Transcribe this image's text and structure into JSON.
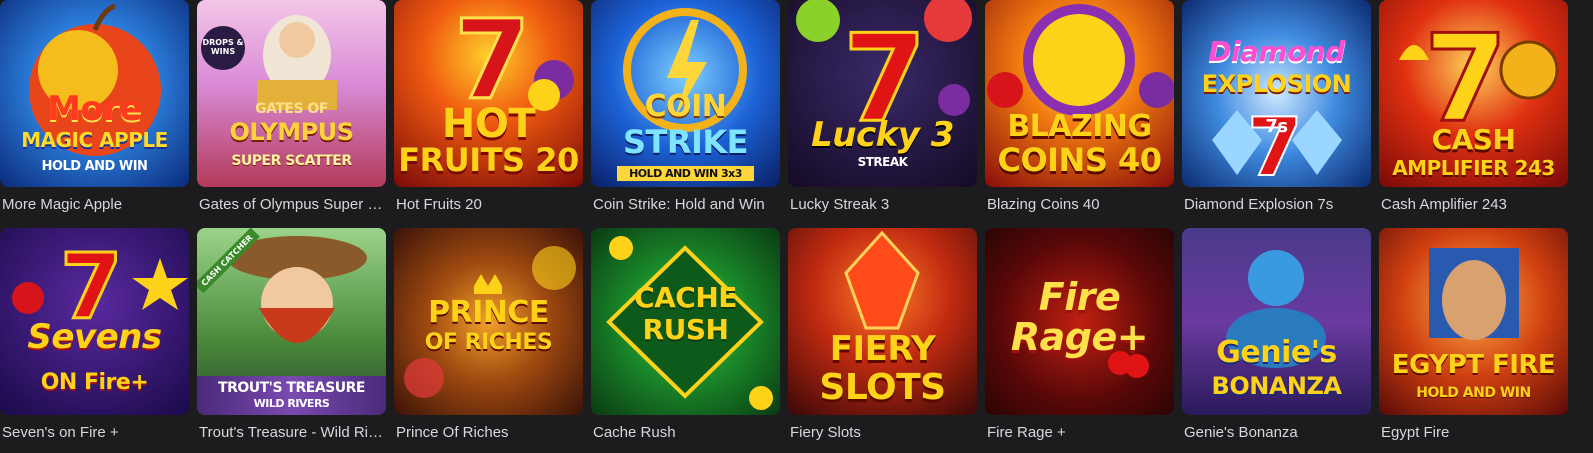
{
  "games": [
    {
      "name": "More Magic Apple",
      "art": {
        "line1": "More",
        "line2": "MAGIC APPLE",
        "line3": "HOLD AND WIN"
      }
    },
    {
      "name": "Gates of Olympus Super Scatter",
      "art": {
        "line1": "GATES OF",
        "line2": "OLYMPUS",
        "line3": "SUPER SCATTER",
        "badge": "DROPS & WINS"
      }
    },
    {
      "name": "Hot Fruits 20",
      "art": {
        "line1": "HOT",
        "line2": "FRUITS 20"
      }
    },
    {
      "name": "Coin Strike: Hold and Win",
      "art": {
        "line1": "COIN",
        "line2": "STRIKE",
        "line3": "HOLD AND WIN 3x3"
      }
    },
    {
      "name": "Lucky Streak 3",
      "art": {
        "line1": "Lucky 3",
        "line2": "STREAK"
      }
    },
    {
      "name": "Blazing Coins 40",
      "art": {
        "line1": "BLAZING",
        "line2": "COINS 40"
      }
    },
    {
      "name": "Diamond Explosion 7s",
      "art": {
        "line1": "Diamond",
        "line2": "EXPLOSION",
        "line3": "7s"
      }
    },
    {
      "name": "Cash Amplifier 243",
      "art": {
        "line1": "CASH",
        "line2": "AMPLIFIER 243"
      }
    },
    {
      "name": "Seven's on Fire +",
      "art": {
        "line1": "Sevens",
        "line2": "ON Fire+"
      }
    },
    {
      "name": "Trout's Treasure - Wild Rivers",
      "art": {
        "line1": "TROUT'S TREASURE",
        "line2": "WILD RIVERS",
        "badge": "CASH CATCHER"
      }
    },
    {
      "name": "Prince Of Riches",
      "art": {
        "line1": "PRINCE",
        "line2": "OF RICHES"
      }
    },
    {
      "name": "Cache Rush",
      "art": {
        "line1": "CACHE",
        "line2": "RUSH"
      }
    },
    {
      "name": "Fiery Slots",
      "art": {
        "line1": "FIERY",
        "line2": "SLOTS"
      }
    },
    {
      "name": "Fire Rage +",
      "art": {
        "line1": "Fire",
        "line2": "Rage+"
      }
    },
    {
      "name": "Genie's Bonanza",
      "art": {
        "line1": "Genie's",
        "line2": "BONANZA"
      }
    },
    {
      "name": "Egypt Fire",
      "art": {
        "line1": "EGYPT FIRE",
        "line2": "HOLD AND WIN"
      }
    }
  ]
}
